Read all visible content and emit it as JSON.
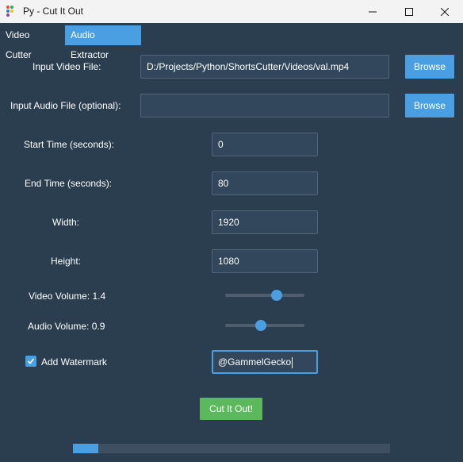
{
  "window": {
    "title": "Py - Cut It Out",
    "icon": "app-icon",
    "controls": [
      "minimize-icon",
      "maximize-icon",
      "close-icon"
    ]
  },
  "tabs": [
    {
      "label": "Video Cutter",
      "selected": false
    },
    {
      "label": "Audio Extractor",
      "selected": true
    }
  ],
  "form": {
    "input_video_label": "Input Video File:",
    "input_video_value": "D:/Projects/Python/ShortsCutter/Videos/val.mp4",
    "input_audio_label": "Input Audio File (optional):",
    "input_audio_value": "",
    "browse_label": "Browse",
    "start_label": "Start Time (seconds):",
    "start_value": "0",
    "end_label": "End Time (seconds):",
    "end_value": "80",
    "width_label": "Width:",
    "width_value": "1920",
    "height_label": "Height:",
    "height_value": "1080",
    "video_volume_label": "Video Volume: 1.4",
    "video_volume": 1.4,
    "video_volume_position": 0.67,
    "audio_volume_label": "Audio Volume: 0.9",
    "audio_volume": 0.9,
    "audio_volume_position": 0.44,
    "watermark_label": "Add Watermark",
    "watermark_checked": true,
    "watermark_value": "@GammelGecko",
    "submit_label": "Cut It Out!"
  },
  "progress": 0.08,
  "colors": {
    "background": "#2b3e50",
    "accent": "#4a9fe2",
    "success": "#5cb85c",
    "field": "#32475b"
  }
}
